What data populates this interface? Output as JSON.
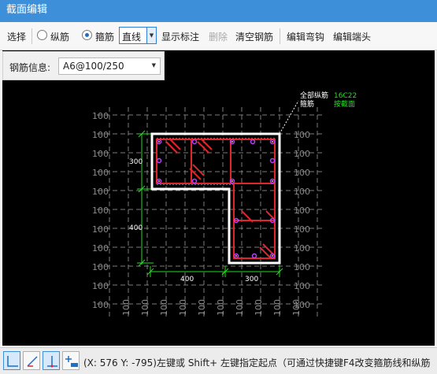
{
  "window": {
    "title": "截面编辑"
  },
  "toolbar": {
    "select": "选择",
    "longitudinal": "纵筋",
    "stirrup": "箍筋",
    "line_mode": "直线",
    "show_labels": "显示标注",
    "delete": "删除",
    "clear_rebar": "清空钢筋",
    "edit_hook": "编辑弯钩",
    "edit_end": "编辑端头",
    "selected_mode": "stirrup"
  },
  "rebar_info": {
    "label": "钢筋信息:",
    "value": "A6@100/250"
  },
  "drawing": {
    "grid_label": "100",
    "dimensions": {
      "top_height": "300",
      "bottom_height": "400",
      "bottom_left": "400",
      "bottom_right": "300"
    },
    "annotation": {
      "left_top": "全部纵筋",
      "left_bottom": "箍筋",
      "right_top": "16C22",
      "right_bottom": "按截面"
    },
    "colors": {
      "background": "#000000",
      "outline": "#ffffff",
      "stirrup": "#e0262b",
      "dimension": "#21e021",
      "grid": "#8a8a8a",
      "rebar_point": "#c040ff"
    }
  },
  "statusbar": {
    "coordinates": "(X: 576 Y: -795)",
    "hint": "左键或 Shift+ 左键指定起点（可通过快捷键F4改变箍筋线和纵筋"
  }
}
